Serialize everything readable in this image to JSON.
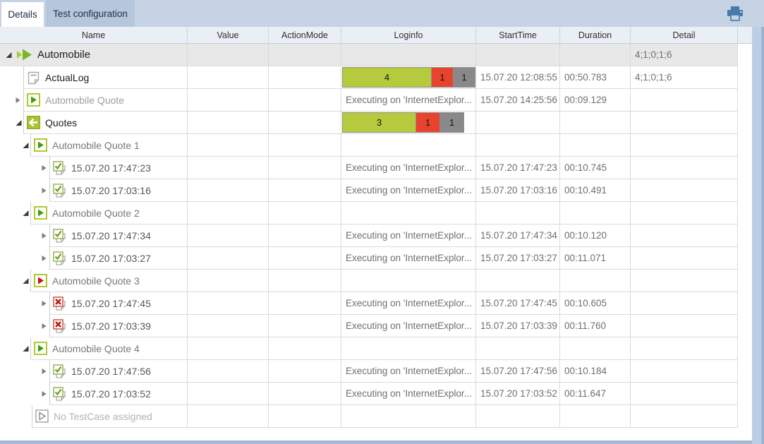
{
  "tabs": {
    "details": "Details",
    "test_configuration": "Test configuration"
  },
  "columns": [
    "Name",
    "Value",
    "ActionMode",
    "Loginfo",
    "StartTime",
    "Duration",
    "Detail"
  ],
  "colors": {
    "bar_green": "#b5ca3d",
    "bar_red": "#e8432e",
    "bar_gray": "#898989",
    "accent_blue": "#4a7aa8",
    "icon_green": "#3da00a",
    "icon_red": "#cc1408",
    "box_border_green": "#b3c832"
  },
  "rows": [
    {
      "label": "Automobile",
      "indent": 20,
      "root": true,
      "expander": "expanded",
      "icon": "suite",
      "text_style": "t-dark lg",
      "loginfo": null,
      "start_time": "",
      "duration": "",
      "detail": "4;1;0;1;6",
      "selected": true
    },
    {
      "label": "ActualLog",
      "indent": 33,
      "root": false,
      "expander": null,
      "icon": "log",
      "text_style": "t-dark",
      "loginfo": {
        "type": "bar",
        "width": 190,
        "segments": [
          {
            "label": "4",
            "units": 4,
            "color": "bar_green"
          },
          {
            "label": "1",
            "units": 1,
            "color": "bar_red"
          },
          {
            "label": "1",
            "units": 1,
            "color": "bar_gray"
          }
        ]
      },
      "start_time": "15.07.20 12:08:55",
      "duration": "00:50.783",
      "detail": "4;1;0;1;6",
      "selected": false
    },
    {
      "label": "Automobile Quote",
      "indent": 33,
      "root": false,
      "expander": "collapsed",
      "icon": "tc-green",
      "text_style": "t-lightgray",
      "loginfo": {
        "type": "text",
        "text": "Executing on 'InternetExplor..."
      },
      "start_time": "15.07.20 14:25:56",
      "duration": "00:09.129",
      "detail": "",
      "selected": false
    },
    {
      "label": "Quotes",
      "indent": 33,
      "root": false,
      "expander": "expanded",
      "icon": "module",
      "text_style": "t-dark",
      "loginfo": {
        "type": "bar",
        "width": 175,
        "segments": [
          {
            "label": "3",
            "units": 3,
            "color": "bar_green"
          },
          {
            "label": "1",
            "units": 1,
            "color": "bar_red"
          },
          {
            "label": "1",
            "units": 1,
            "color": "bar_gray"
          }
        ]
      },
      "start_time": "",
      "duration": "",
      "detail": "",
      "selected": false
    },
    {
      "label": "Automobile Quote 1",
      "indent": 43,
      "root": false,
      "expander": "expanded",
      "icon": "tc-green",
      "text_style": "t-gray",
      "loginfo": null,
      "start_time": "",
      "duration": "",
      "detail": "",
      "selected": false
    },
    {
      "label": "15.07.20 17:47:23",
      "indent": 70,
      "root": false,
      "expander": "collapsed",
      "icon": "log-check",
      "text_style": "t-mid",
      "loginfo": {
        "type": "text",
        "text": "Executing on 'InternetExplor..."
      },
      "start_time": "15.07.20 17:47:23",
      "duration": "00:10.745",
      "detail": "",
      "selected": false
    },
    {
      "label": "15.07.20 17:03:16",
      "indent": 70,
      "root": false,
      "expander": "collapsed",
      "icon": "log-check",
      "text_style": "t-mid",
      "loginfo": {
        "type": "text",
        "text": "Executing on 'InternetExplor..."
      },
      "start_time": "15.07.20 17:03:16",
      "duration": "00:10.491",
      "detail": "",
      "selected": false
    },
    {
      "label": "Automobile Quote 2",
      "indent": 43,
      "root": false,
      "expander": "expanded",
      "icon": "tc-green",
      "text_style": "t-gray",
      "loginfo": null,
      "start_time": "",
      "duration": "",
      "detail": "",
      "selected": false
    },
    {
      "label": "15.07.20 17:47:34",
      "indent": 70,
      "root": false,
      "expander": "collapsed",
      "icon": "log-check",
      "text_style": "t-mid",
      "loginfo": {
        "type": "text",
        "text": "Executing on 'InternetExplor..."
      },
      "start_time": "15.07.20 17:47:34",
      "duration": "00:10.120",
      "detail": "",
      "selected": false
    },
    {
      "label": "15.07.20 17:03:27",
      "indent": 70,
      "root": false,
      "expander": "collapsed",
      "icon": "log-check",
      "text_style": "t-mid",
      "loginfo": {
        "type": "text",
        "text": "Executing on 'InternetExplor..."
      },
      "start_time": "15.07.20 17:03:27",
      "duration": "00:11.071",
      "detail": "",
      "selected": false
    },
    {
      "label": "Automobile Quote 3",
      "indent": 43,
      "root": false,
      "expander": "expanded",
      "icon": "tc-red",
      "text_style": "t-gray",
      "loginfo": null,
      "start_time": "",
      "duration": "",
      "detail": "",
      "selected": false
    },
    {
      "label": "15.07.20 17:47:45",
      "indent": 70,
      "root": false,
      "expander": "collapsed",
      "icon": "log-x",
      "text_style": "t-mid",
      "loginfo": {
        "type": "text",
        "text": "Executing on 'InternetExplor..."
      },
      "start_time": "15.07.20 17:47:45",
      "duration": "00:10.605",
      "detail": "",
      "selected": false
    },
    {
      "label": "15.07.20 17:03:39",
      "indent": 70,
      "root": false,
      "expander": "collapsed",
      "icon": "log-x",
      "text_style": "t-mid",
      "loginfo": {
        "type": "text",
        "text": "Executing on 'InternetExplor..."
      },
      "start_time": "15.07.20 17:03:39",
      "duration": "00:11.760",
      "detail": "",
      "selected": false
    },
    {
      "label": "Automobile Quote 4",
      "indent": 43,
      "root": false,
      "expander": "expanded",
      "icon": "tc-green",
      "text_style": "t-gray",
      "loginfo": null,
      "start_time": "",
      "duration": "",
      "detail": "",
      "selected": false
    },
    {
      "label": "15.07.20 17:47:56",
      "indent": 70,
      "root": false,
      "expander": "collapsed",
      "icon": "log-check",
      "text_style": "t-mid",
      "loginfo": {
        "type": "text",
        "text": "Executing on 'InternetExplor..."
      },
      "start_time": "15.07.20 17:47:56",
      "duration": "00:10.184",
      "detail": "",
      "selected": false
    },
    {
      "label": "15.07.20 17:03:52",
      "indent": 70,
      "root": false,
      "expander": "collapsed",
      "icon": "log-check",
      "text_style": "t-mid",
      "loginfo": {
        "type": "text",
        "text": "Executing on 'InternetExplor..."
      },
      "start_time": "15.07.20 17:03:52",
      "duration": "00:11.647",
      "detail": "",
      "selected": false
    },
    {
      "label": "No TestCase assigned",
      "indent": 45,
      "root": false,
      "expander": null,
      "icon": "placeholder",
      "text_style": "t-faint",
      "loginfo": null,
      "start_time": "",
      "duration": "",
      "detail": "",
      "selected": false
    }
  ]
}
